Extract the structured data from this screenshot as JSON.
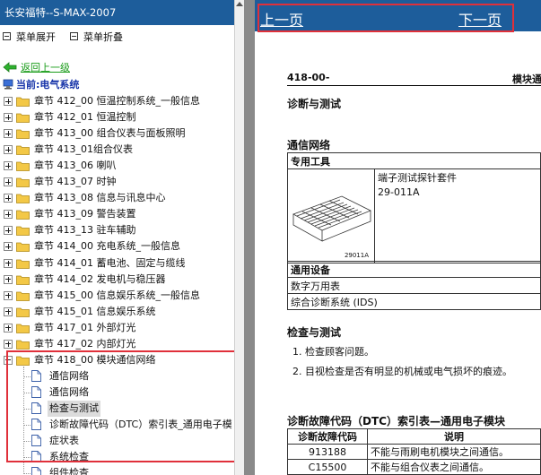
{
  "left_pane": {
    "title": "长安福特--S-MAX-2007",
    "menu": {
      "expand": "菜单展开",
      "collapse": "菜单折叠"
    },
    "back_link": "返回上一级",
    "current": "当前:电气系统",
    "chapters": [
      {
        "label": "章节 412_00 恒温控制系统_一般信息",
        "expanded": false
      },
      {
        "label": "章节 412_01 恒温控制",
        "expanded": false
      },
      {
        "label": "章节 413_00 组合仪表与面板照明",
        "expanded": false
      },
      {
        "label": "章节 413_01组合仪表",
        "expanded": false
      },
      {
        "label": "章节 413_06 喇叭",
        "expanded": false
      },
      {
        "label": "章节 413_07 时钟",
        "expanded": false
      },
      {
        "label": "章节 413_08 信息与讯息中心",
        "expanded": false
      },
      {
        "label": "章节 413_09 警告装置",
        "expanded": false
      },
      {
        "label": "章节 413_13 驻车辅助",
        "expanded": false
      },
      {
        "label": "章节 414_00 充电系统_一般信息",
        "expanded": false
      },
      {
        "label": "章节 414_01 蓄电池、固定与缆线",
        "expanded": false
      },
      {
        "label": "章节 414_02 发电机与稳压器",
        "expanded": false
      },
      {
        "label": "章节 415_00 信息娱乐系统_一般信息",
        "expanded": false
      },
      {
        "label": "章节 415_01 信息娱乐系统",
        "expanded": false
      },
      {
        "label": "章节 417_01 外部灯光",
        "expanded": false
      },
      {
        "label": "章节 417_02 内部灯光",
        "expanded": false
      },
      {
        "label": "章节 418_00 模块通信网络",
        "expanded": true
      }
    ],
    "sub_items": [
      {
        "label": "通信网络",
        "selected": false
      },
      {
        "label": "通信网络",
        "selected": false
      },
      {
        "label": "检查与测试",
        "selected": true
      },
      {
        "label": "诊断故障代码（DTC）索引表_通用电子模",
        "selected": false
      },
      {
        "label": "症状表",
        "selected": false
      },
      {
        "label": "系统检查",
        "selected": false
      },
      {
        "label": "组件检查",
        "selected": false
      }
    ]
  },
  "right_pane": {
    "prev": "上一页",
    "next": "下一页",
    "doc_code": "418-00-",
    "doc_module": "模块通",
    "heading_diag": "诊断与测试",
    "heading_comm": "通信网络",
    "tools": {
      "header": "专用工具",
      "image_caption": "29011A",
      "name": "端子测试探针套件",
      "part_no": "29-011A"
    },
    "equipment": {
      "header": "通用设备",
      "rows": [
        "数字万用表",
        "综合诊断系统 (IDS)"
      ]
    },
    "heading_inspect": "检查与测试",
    "steps": [
      "1. 检查顾客问题。",
      "2. 目视检查是否有明显的机械或电气损坏的痕迹。"
    ],
    "heading_dtc": "诊断故障代码（DTC）索引表—通用电子模块",
    "dtc": {
      "col_code": "诊断故障代码",
      "col_desc": "说明",
      "rows": [
        {
          "code": "913188",
          "desc": "不能与雨刷电机模块之间通信。"
        },
        {
          "code": "C15500",
          "desc": "不能与组合仪表之间通信。"
        }
      ]
    }
  },
  "colors": {
    "title_bar": "#1d5d9b",
    "highlight_box": "#e0303a",
    "current_label": "#1633a8",
    "back_link": "#1a9c1a",
    "folder": "#f3c846"
  }
}
